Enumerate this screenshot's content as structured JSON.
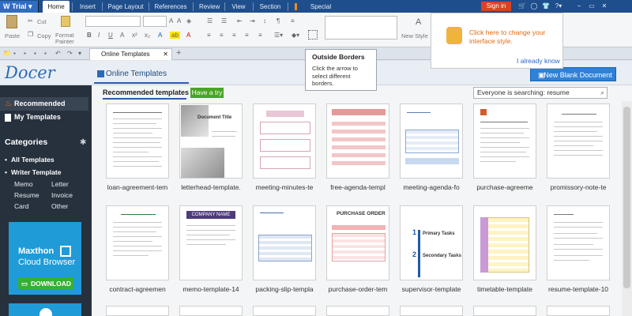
{
  "app": {
    "name": "Trial"
  },
  "menu": [
    "Home",
    "Insert",
    "Page Layout",
    "References",
    "Review",
    "View",
    "Section",
    "Special Features"
  ],
  "actions": {
    "signin": "Sign in"
  },
  "ribbon": {
    "paste": "Paste",
    "cut": "Cut",
    "copy": "Copy",
    "format": "Format",
    "painter": "Painter",
    "new_style": "New Style"
  },
  "tabs": {
    "doc_tab": "Online Templates"
  },
  "tooltip": {
    "title": "Outside Borders",
    "body": "Click the arrow to select different borders."
  },
  "popup": {
    "text": "Click here to change your interface style.",
    "link": "I already know"
  },
  "header": {
    "logo": "Docer",
    "tab": "Online Templates",
    "new_blank": "New Blank Document"
  },
  "sidebar": {
    "recommended": "Recommended",
    "my_templates": "My Templates",
    "categories": "Categories",
    "all_templates": "All Templates",
    "writer_template": "Writer Template",
    "subs": [
      "Memo",
      "Letter",
      "Resume",
      "Invoice",
      "Card",
      "Other"
    ],
    "ad_line1": "Maxthon",
    "ad_line2": "Cloud Browser",
    "ad_button": "DOWNLOAD"
  },
  "main": {
    "recommended_title": "Recommended templates",
    "have_a_try": "Have a try",
    "search_text": "Everyone is searching: resume",
    "row1": [
      "loan-agreement-tem",
      "letterhead-template.",
      "meeting-minutes-te",
      "free-agenda-templ",
      "meeting-agenda-fo",
      "purchase-agreeme",
      "promissory-note-te"
    ],
    "row2": [
      "contract-agreemen",
      "memo-template-14",
      "packing-slip-templa",
      "purchase-order-tem",
      "supervisor-template",
      "timetable-template",
      "resume-template-10"
    ]
  },
  "thumb_text": {
    "doc_title": "Document Title",
    "company_name": "COMPANY NAME",
    "purchase_order": "PURCHASE ORDER",
    "primary_tasks": "Primary Tasks",
    "secondary_tasks": "Secondary Tasks"
  },
  "colors": {
    "menubar": "#1f4e8c",
    "sidebar": "#27313e",
    "accent": "#2f81d6",
    "green": "#4aa426",
    "signin": "#d94324"
  }
}
